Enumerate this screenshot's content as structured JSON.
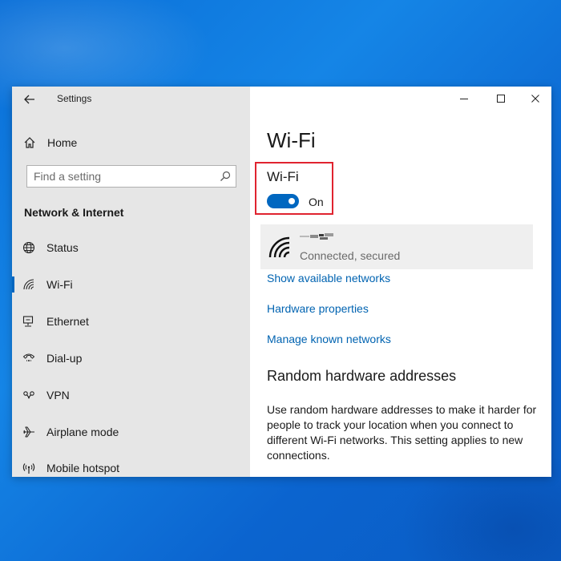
{
  "window": {
    "title": "Settings"
  },
  "sidebar": {
    "home_label": "Home",
    "search": {
      "placeholder": "Find a setting"
    },
    "section_heading": "Network & Internet",
    "items": [
      {
        "label": "Status",
        "icon": "globe-icon"
      },
      {
        "label": "Wi-Fi",
        "icon": "wifi-icon",
        "selected": true
      },
      {
        "label": "Ethernet",
        "icon": "ethernet-icon"
      },
      {
        "label": "Dial-up",
        "icon": "dialup-icon"
      },
      {
        "label": "VPN",
        "icon": "vpn-icon"
      },
      {
        "label": "Airplane mode",
        "icon": "airplane-icon"
      },
      {
        "label": "Mobile hotspot",
        "icon": "hotspot-icon"
      }
    ]
  },
  "main": {
    "page_title": "Wi-Fi",
    "wifi_toggle": {
      "label": "Wi-Fi",
      "state": "On",
      "on": true
    },
    "network": {
      "status": "Connected, secured"
    },
    "links": [
      "Show available networks",
      "Hardware properties",
      "Manage known networks"
    ],
    "random_hw": {
      "heading": "Random hardware addresses",
      "description": "Use random hardware addresses to make it harder for people to track your location when you connect to different Wi-Fi networks. This setting applies to new connections."
    }
  },
  "colors": {
    "accent": "#0067c0",
    "link": "#0063b1",
    "highlight_box": "#e0232f",
    "sidebar_bg": "#e6e6e6",
    "desktop_bg": "#1585e6"
  }
}
